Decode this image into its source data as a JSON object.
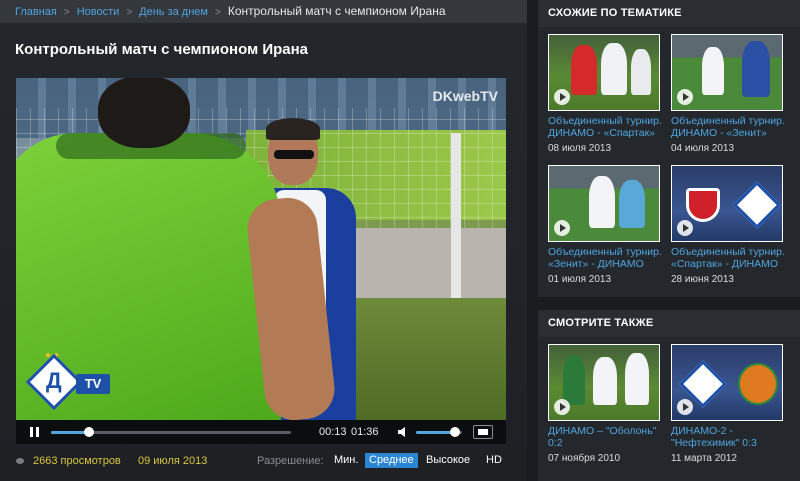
{
  "breadcrumbs": [
    {
      "label": "Главная"
    },
    {
      "label": "Новости"
    },
    {
      "label": "День за днем"
    }
  ],
  "breadcrumb_current": "Контрольный матч с чемпионом Ирана",
  "page_title": "Контрольный матч с чемпионом Ирана",
  "video": {
    "watermark": "DKwebTV",
    "logo_text": "TV",
    "logo_letter": "Д",
    "elapsed": "00:13",
    "duration": "01:36",
    "progress": 0.16,
    "volume": 0.85
  },
  "meta": {
    "views": "2663 просмотров",
    "date": "09 июля 2013",
    "resolution_label": "Разрешение:",
    "resolutions": [
      "Мин.",
      "Среднее",
      "Высокое",
      "HD"
    ],
    "selected_resolution": "Среднее"
  },
  "related": {
    "header": "СХОЖИЕ ПО ТЕМАТИКЕ",
    "items": [
      {
        "title": "Объединенный турнир. ДИНАМО - «Спартак»",
        "date": "08 июля 2013",
        "thumb": "match-red-white"
      },
      {
        "title": "Объединенный турнир. ДИНАМО - «Зенит»",
        "date": "04 июля 2013",
        "thumb": "match-blue-white"
      },
      {
        "title": "Объединенный турнир. «Зенит» - ДИНАМО",
        "date": "01 июля 2013",
        "thumb": "match-lightblue-white"
      },
      {
        "title": "Объединенный турнир. «Спартак» - ДИНАМО",
        "date": "28 июня 2013",
        "thumb": "logos-spartak-dynamo"
      }
    ]
  },
  "see_also": {
    "header": "СМОТРИТЕ ТАКЖЕ",
    "items": [
      {
        "title": "ДИНАМО – \"Оболонь\" 0:2",
        "date": "07 ноября 2010",
        "thumb": "match-green-white"
      },
      {
        "title": "ДИНАМО-2 - \"Нефтехимик\" 0:3",
        "date": "11 марта 2012",
        "thumb": "logos-dynamo-neftekhimik"
      }
    ]
  },
  "colors": {
    "link": "#4fa6e0",
    "accent_yellow": "#d8c740",
    "active_resolution": "#2a86d0"
  }
}
